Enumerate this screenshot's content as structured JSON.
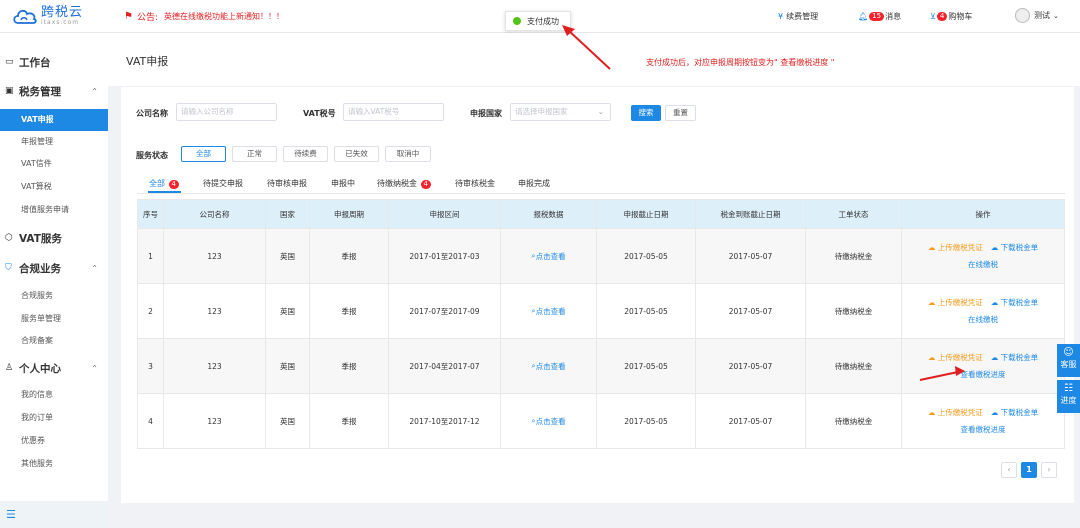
{
  "brand": {
    "name": "跨税云",
    "sub": "itaxs.com",
    "color": "#1e6fd6"
  },
  "notice": {
    "label": "公告:",
    "message": "英德在线缴税功能上新通知！！！"
  },
  "toast": {
    "text": "支付成功"
  },
  "topnav": {
    "renew": "续费管理",
    "messages": "消息",
    "messages_count": "15",
    "cart": "购物车",
    "cart_count": "4",
    "user": "测试"
  },
  "sidebar": {
    "workbench": "工作台",
    "tax": {
      "label": "税务管理",
      "items": [
        "VAT申报",
        "年报管理",
        "VAT信件",
        "VAT算税",
        "增值服务申请"
      ]
    },
    "vat_service": "VAT服务",
    "compliance": {
      "label": "合规业务",
      "items": [
        "合规服务",
        "服务单管理",
        "合规备案"
      ]
    },
    "personal": {
      "label": "个人中心",
      "items": [
        "我的信息",
        "我的订单",
        "优惠券",
        "其他服务"
      ]
    }
  },
  "page": {
    "title": "VAT申报",
    "annotation": "支付成功后，对应申报周期按钮变为\" 查看缴税进度 \""
  },
  "filters": {
    "company_label": "公司名称",
    "company_placeholder": "请输入公司名称",
    "vat_label": "VAT税号",
    "vat_placeholder": "请输入VAT税号",
    "country_label": "申报国家",
    "country_placeholder": "请选择申报国家",
    "search": "搜索",
    "reset": "重置",
    "status_label": "服务状态",
    "statuses": [
      "全部",
      "正常",
      "待续费",
      "已失效",
      "取消中"
    ]
  },
  "tabs": [
    {
      "label": "全部",
      "badge": "4"
    },
    {
      "label": "待提交申报",
      "badge": ""
    },
    {
      "label": "待审核申报",
      "badge": ""
    },
    {
      "label": "申报中",
      "badge": ""
    },
    {
      "label": "待缴纳税金",
      "badge": "4"
    },
    {
      "label": "待审核税金",
      "badge": ""
    },
    {
      "label": "申报完成",
      "badge": ""
    }
  ],
  "table": {
    "headers": [
      "序号",
      "公司名称",
      "国家",
      "申报周期",
      "申报区间",
      "报税数据",
      "申报截止日期",
      "税金到账截止日期",
      "工单状态",
      "操作"
    ],
    "rows": [
      {
        "no": "1",
        "company": "123",
        "country": "英国",
        "cycle": "季报",
        "range": "2017-01至2017-03",
        "data": "点击查看",
        "deadline": "2017-05-05",
        "tax_deadline": "2017-05-07",
        "status": "待缴纳税金",
        "op_upload": "上传缴税凭证",
        "op_download": "下载税金单",
        "op_main": "在线缴税"
      },
      {
        "no": "2",
        "company": "123",
        "country": "英国",
        "cycle": "季报",
        "range": "2017-07至2017-09",
        "data": "点击查看",
        "deadline": "2017-05-05",
        "tax_deadline": "2017-05-07",
        "status": "待缴纳税金",
        "op_upload": "上传缴税凭证",
        "op_download": "下载税金单",
        "op_main": "在线缴税"
      },
      {
        "no": "3",
        "company": "123",
        "country": "英国",
        "cycle": "季报",
        "range": "2017-04至2017-07",
        "data": "点击查看",
        "deadline": "2017-05-05",
        "tax_deadline": "2017-05-07",
        "status": "待缴纳税金",
        "op_upload": "上传缴税凭证",
        "op_download": "下载税金单",
        "op_main": "查看缴税进度"
      },
      {
        "no": "4",
        "company": "123",
        "country": "英国",
        "cycle": "季报",
        "range": "2017-10至2017-12",
        "data": "点击查看",
        "deadline": "2017-05-05",
        "tax_deadline": "2017-05-07",
        "status": "待缴纳税金",
        "op_upload": "上传缴税凭证",
        "op_download": "下载税金单",
        "op_main": "查看缴税进度"
      }
    ]
  },
  "pager": {
    "prev": "‹",
    "current": "1",
    "next": "›"
  },
  "floats": {
    "service": "客服",
    "progress": "进度"
  },
  "colors": {
    "primary": "#1e88e5",
    "danger": "#e02020",
    "warning": "#f29b1d",
    "success": "#52c41a"
  }
}
